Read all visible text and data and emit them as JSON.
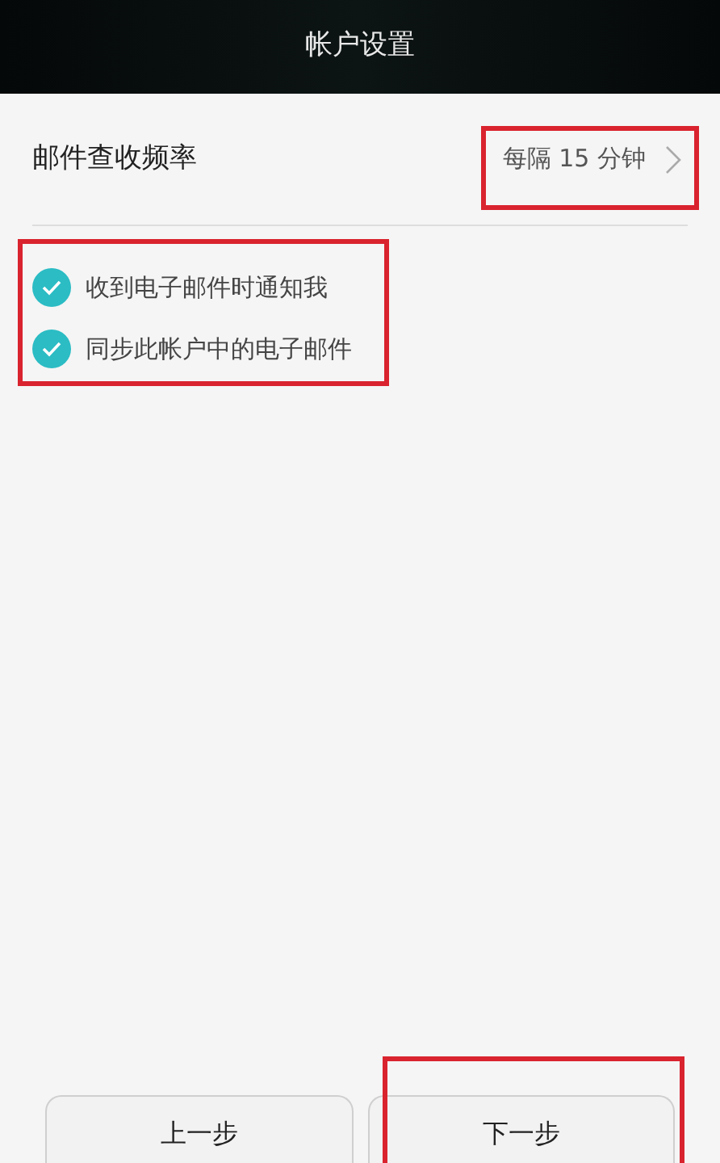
{
  "header": {
    "title": "帐户设置"
  },
  "frequency": {
    "label": "邮件查收频率",
    "value": "每隔 15 分钟",
    "highlighted": true
  },
  "options_highlighted": true,
  "options": [
    {
      "label": "收到电子邮件时通知我",
      "checked": true
    },
    {
      "label": "同步此帐户中的电子邮件",
      "checked": true
    }
  ],
  "buttons": [
    {
      "label": "上一步",
      "highlighted": false
    },
    {
      "label": "下一步",
      "highlighted": true
    }
  ]
}
